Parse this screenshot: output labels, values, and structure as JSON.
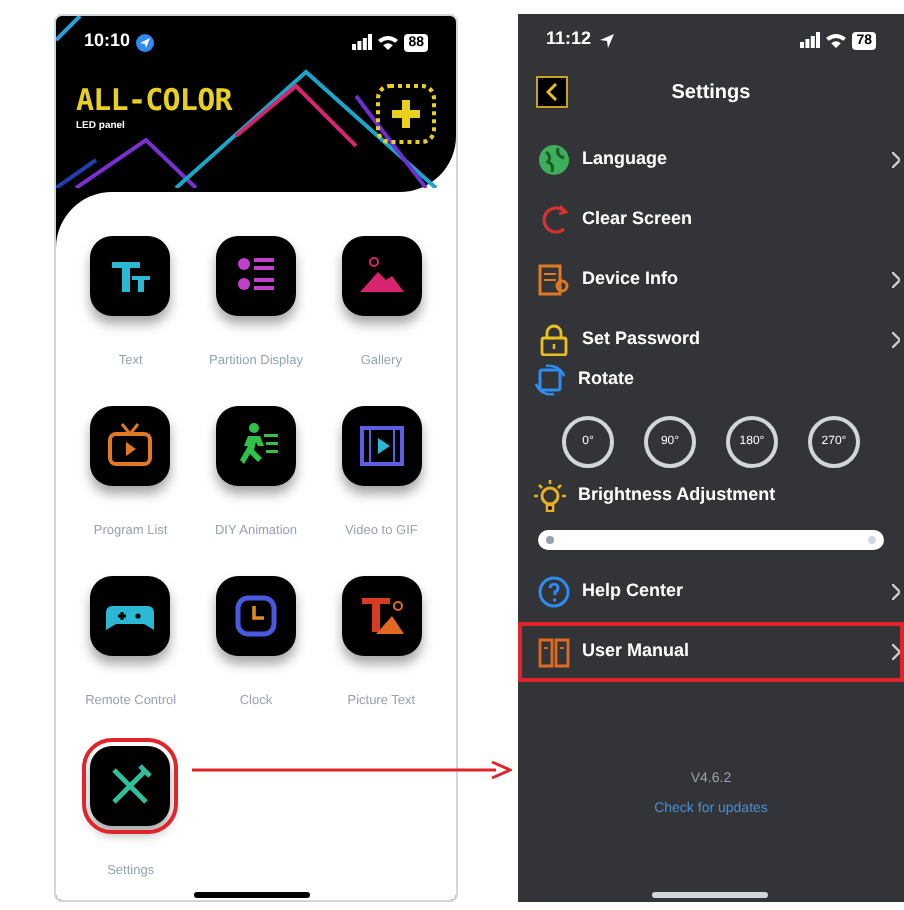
{
  "home_screen": {
    "status_bar": {
      "time": "10:10",
      "battery": "88"
    },
    "brand": {
      "title": "ALL-COLOR",
      "subtitle": "LED panel"
    },
    "apps": [
      {
        "label": "Text",
        "highlighted": false
      },
      {
        "label": "Partition Display",
        "highlighted": false
      },
      {
        "label": "Gallery",
        "highlighted": false
      },
      {
        "label": "Program List",
        "highlighted": false
      },
      {
        "label": "DIY Animation",
        "highlighted": false
      },
      {
        "label": "Video to GIF",
        "highlighted": false
      },
      {
        "label": "Remote Control",
        "highlighted": false
      },
      {
        "label": "Clock",
        "highlighted": false
      },
      {
        "label": "Picture Text",
        "highlighted": false
      },
      {
        "label": "Settings",
        "highlighted": true
      }
    ]
  },
  "settings_screen": {
    "status_bar": {
      "time": "11:12",
      "battery": "78"
    },
    "title": "Settings",
    "items": [
      {
        "kind": "link",
        "label": "Language",
        "highlighted": false
      },
      {
        "kind": "plain",
        "label": "Clear Screen",
        "highlighted": false
      },
      {
        "kind": "link",
        "label": "Device Info",
        "highlighted": false
      },
      {
        "kind": "link",
        "label": "Set Password",
        "highlighted": false
      },
      {
        "kind": "rotate",
        "label": "Rotate",
        "options": [
          "0°",
          "90°",
          "180°",
          "270°"
        ]
      },
      {
        "kind": "slider",
        "label": "Brightness Adjustment",
        "level": 0
      },
      {
        "kind": "link",
        "label": "Help Center",
        "highlighted": false
      },
      {
        "kind": "link",
        "label": "User Manual",
        "highlighted": true
      }
    ],
    "version": "V4.6.2",
    "update_link": "Check for updates"
  }
}
